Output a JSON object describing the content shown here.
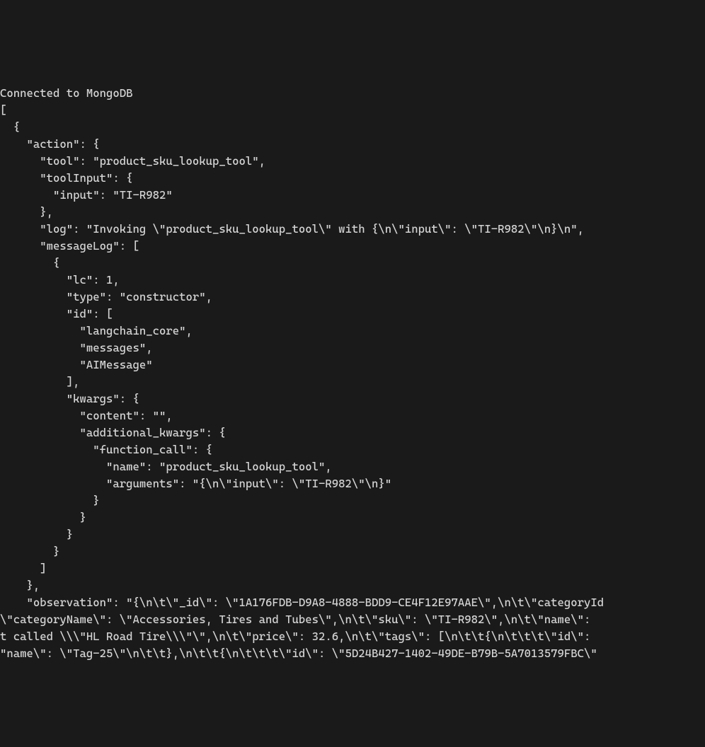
{
  "terminal": {
    "lines": [
      "Connected to MongoDB",
      "[",
      "  {",
      "    \"action\": {",
      "      \"tool\": \"product_sku_lookup_tool\",",
      "      \"toolInput\": {",
      "        \"input\": \"TI-R982\"",
      "      },",
      "      \"log\": \"Invoking \\\"product_sku_lookup_tool\\\" with {\\n\\\"input\\\": \\\"TI-R982\\\"\\n}\\n\",",
      "      \"messageLog\": [",
      "        {",
      "          \"lc\": 1,",
      "          \"type\": \"constructor\",",
      "          \"id\": [",
      "            \"langchain_core\",",
      "            \"messages\",",
      "            \"AIMessage\"",
      "          ],",
      "          \"kwargs\": {",
      "            \"content\": \"\",",
      "            \"additional_kwargs\": {",
      "              \"function_call\": {",
      "                \"name\": \"product_sku_lookup_tool\",",
      "                \"arguments\": \"{\\n\\\"input\\\": \\\"TI-R982\\\"\\n}\"",
      "              }",
      "            }",
      "          }",
      "        }",
      "      ]",
      "    },",
      "    \"observation\": \"{\\n\\t\\\"_id\\\": \\\"1A176FDB-D9A8-4888-BDD9-CE4F12E97AAE\\\",\\n\\t\\\"categoryId",
      "\\\"categoryName\\\": \\\"Accessories, Tires and Tubes\\\",\\n\\t\\\"sku\\\": \\\"TI-R982\\\",\\n\\t\\\"name\\\":",
      "t called \\\\\\\"HL Road Tire\\\\\\\"\\\",\\n\\t\\\"price\\\": 32.6,\\n\\t\\\"tags\\\": [\\n\\t\\t{\\n\\t\\t\\t\\\"id\\\":",
      "\"name\\\": \\\"Tag-25\\\"\\n\\t\\t},\\n\\t\\t{\\n\\t\\t\\t\\\"id\\\": \\\"5D24B427-1402-49DE-B79B-5A7013579FBC\\\""
    ]
  }
}
